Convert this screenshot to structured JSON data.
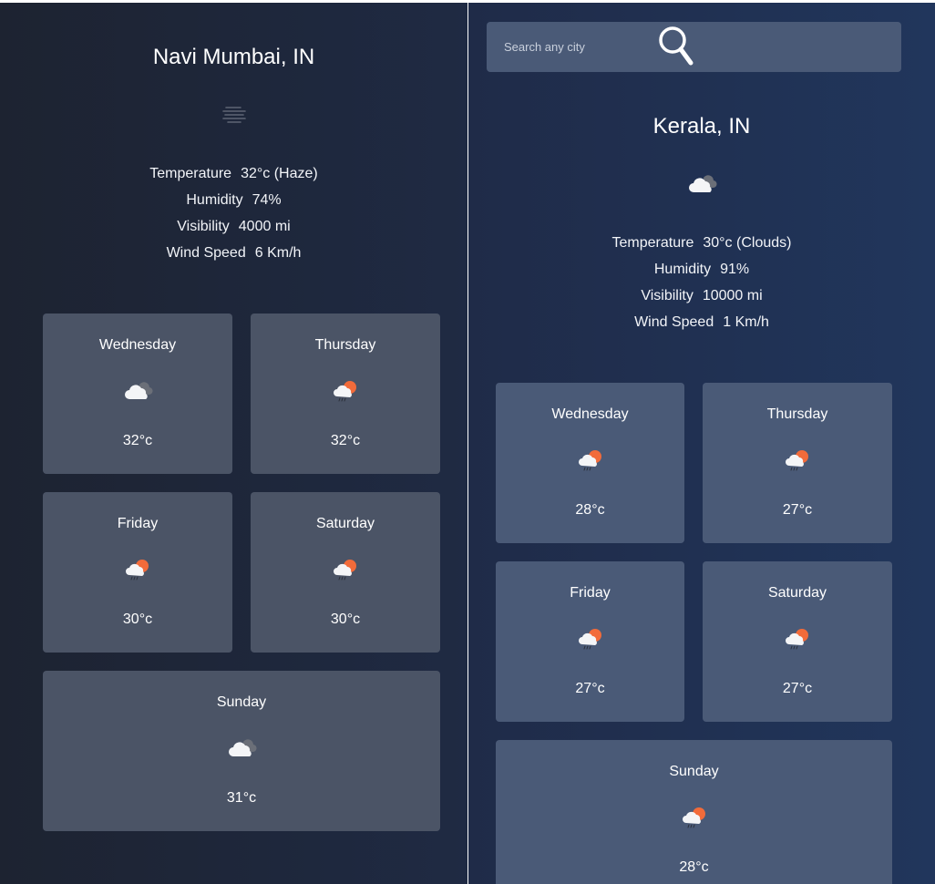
{
  "left": {
    "city": "Navi Mumbai, IN",
    "main_icon": "haze-icon",
    "stats": [
      {
        "label": "Temperature",
        "value": "32°c (Haze)"
      },
      {
        "label": "Humidity",
        "value": "74%"
      },
      {
        "label": "Visibility",
        "value": "4000 mi"
      },
      {
        "label": "Wind Speed",
        "value": "6 Km/h"
      }
    ],
    "forecast": [
      {
        "day": "Wednesday",
        "temp": "32°c",
        "icon": "cloudy-icon"
      },
      {
        "day": "Thursday",
        "temp": "32°c",
        "icon": "rain-sun-icon"
      },
      {
        "day": "Friday",
        "temp": "30°c",
        "icon": "rain-sun-icon"
      },
      {
        "day": "Saturday",
        "temp": "30°c",
        "icon": "rain-sun-icon"
      },
      {
        "day": "Sunday",
        "temp": "31°c",
        "icon": "cloudy-icon"
      }
    ]
  },
  "right": {
    "search": {
      "placeholder": "Search any city",
      "icon": "search-icon"
    },
    "city": "Kerala, IN",
    "main_icon": "cloudy-icon",
    "stats": [
      {
        "label": "Temperature",
        "value": "30°c (Clouds)"
      },
      {
        "label": "Humidity",
        "value": "91%"
      },
      {
        "label": "Visibility",
        "value": "10000 mi"
      },
      {
        "label": "Wind Speed",
        "value": "1 Km/h"
      }
    ],
    "forecast": [
      {
        "day": "Wednesday",
        "temp": "28°c",
        "icon": "rain-sun-icon"
      },
      {
        "day": "Thursday",
        "temp": "27°c",
        "icon": "rain-sun-icon"
      },
      {
        "day": "Friday",
        "temp": "27°c",
        "icon": "rain-sun-icon"
      },
      {
        "day": "Saturday",
        "temp": "27°c",
        "icon": "rain-sun-icon"
      },
      {
        "day": "Sunday",
        "temp": "28°c",
        "icon": "rain-sun-icon"
      }
    ]
  },
  "colors": {
    "left_bg": "#1d2331",
    "right_bg": "#21365c",
    "card_left": "#4b5466",
    "card_right": "#4a5a77",
    "sun": "#f26b3a"
  }
}
